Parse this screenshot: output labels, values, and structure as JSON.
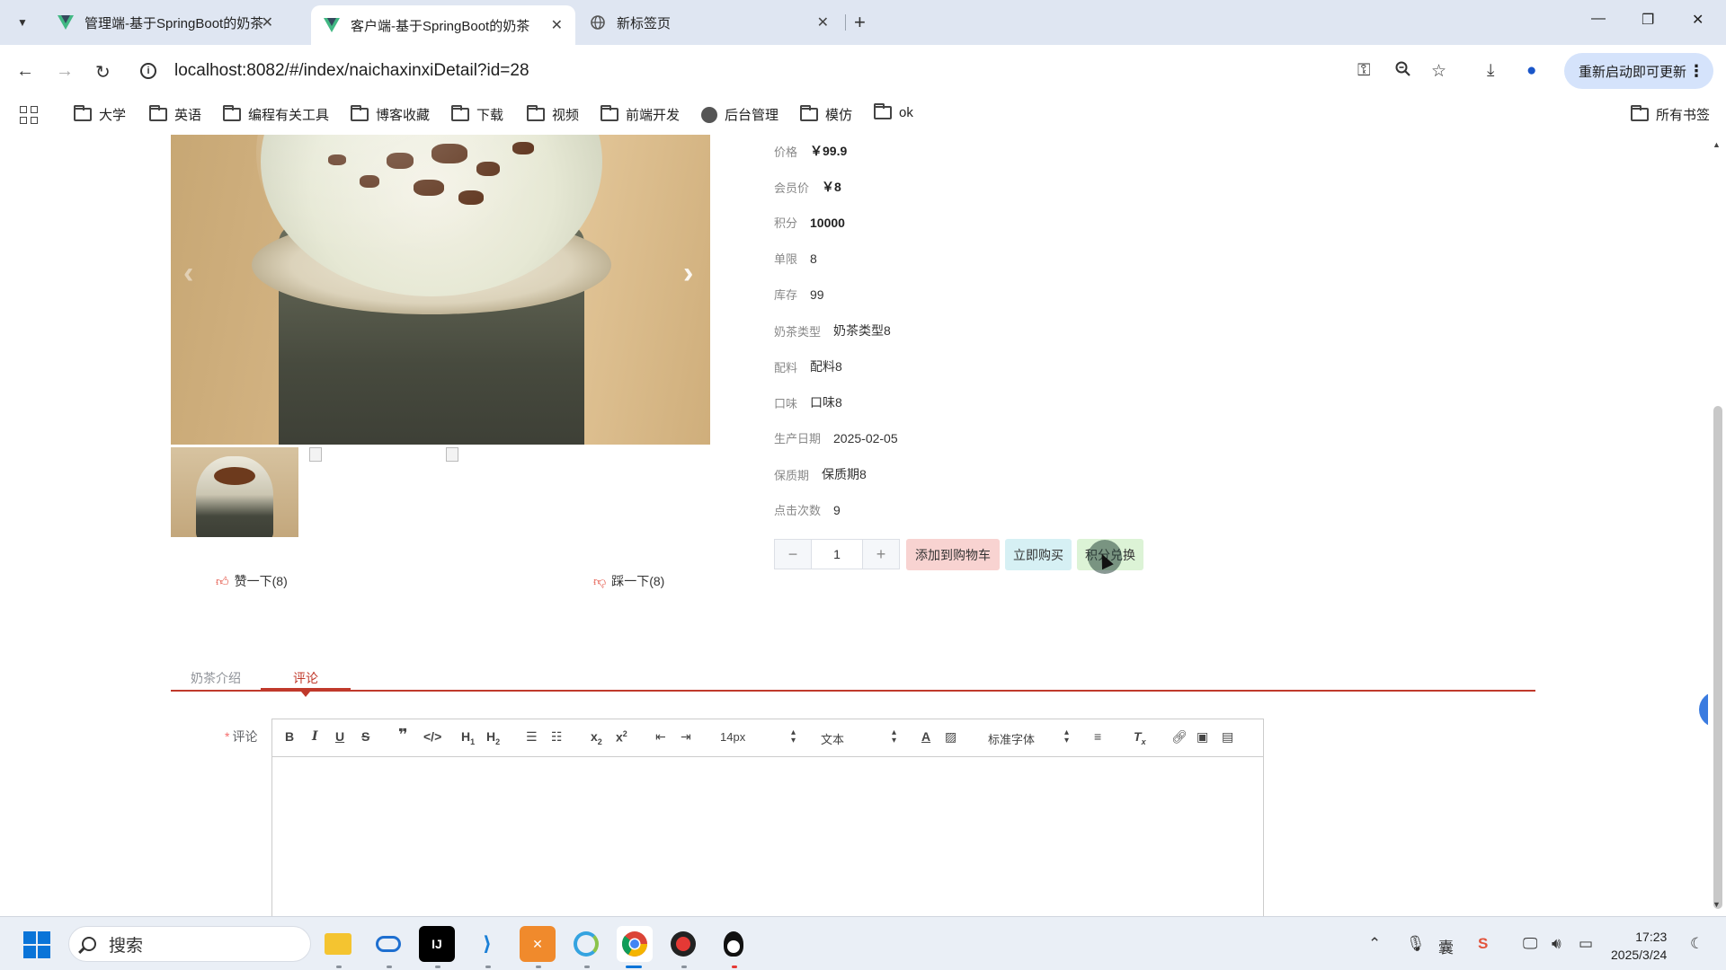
{
  "browser": {
    "tabs": [
      {
        "title": "管理端-基于SpringBoot的奶茶",
        "icon": "vue-logo-icon",
        "active": false
      },
      {
        "title": "客户端-基于SpringBoot的奶茶",
        "icon": "vue-logo-icon",
        "active": true
      },
      {
        "title": "新标签页",
        "icon": "globe-icon",
        "active": false
      }
    ],
    "url": "localhost:8082/#/index/naichaxinxiDetail?id=28",
    "update_button": "重新启动即可更新",
    "bookmarks": [
      "大学",
      "英语",
      "编程有关工具",
      "博客收藏",
      "下载",
      "视频",
      "前端开发",
      "后台管理",
      "模仿",
      "ok"
    ],
    "all_bookmarks": "所有书签"
  },
  "product": {
    "fields": [
      {
        "label": "价格",
        "value": "￥99.9",
        "bold": true
      },
      {
        "label": "会员价",
        "value": "￥8",
        "bold": true
      },
      {
        "label": "积分",
        "value": "10000",
        "bold": true
      },
      {
        "label": "单限",
        "value": "8",
        "bold": false
      },
      {
        "label": "库存",
        "value": "99",
        "bold": false
      },
      {
        "label": "奶茶类型",
        "value": "奶茶类型8",
        "bold": false
      },
      {
        "label": "配料",
        "value": "配料8",
        "bold": false
      },
      {
        "label": "口味",
        "value": "口味8",
        "bold": false
      },
      {
        "label": "生产日期",
        "value": "2025-02-05",
        "bold": false
      },
      {
        "label": "保质期",
        "value": "保质期8",
        "bold": false
      },
      {
        "label": "点击次数",
        "value": "9",
        "bold": false
      }
    ],
    "quantity": "1",
    "buttons": {
      "add_to_cart": "添加到购物车",
      "buy_now": "立即购买",
      "redeem_points": "积分兑换"
    },
    "like": "赞一下(8)",
    "dislike": "踩一下(8)"
  },
  "page_tabs": [
    "奶茶介绍",
    "评论"
  ],
  "comment": {
    "label": "评论",
    "required_mark": "*",
    "font_size": "14px",
    "text_type": "文本",
    "font_family": "标准字体"
  },
  "taskbar": {
    "search_placeholder": "搜索",
    "time": "17:23",
    "date": "2025/3/24"
  },
  "colors": {
    "accent": "#c0392b",
    "add_cart_bg": "#f8d3d1",
    "buy_now_bg": "#d6f0f4",
    "redeem_bg": "#dcf3d6"
  }
}
